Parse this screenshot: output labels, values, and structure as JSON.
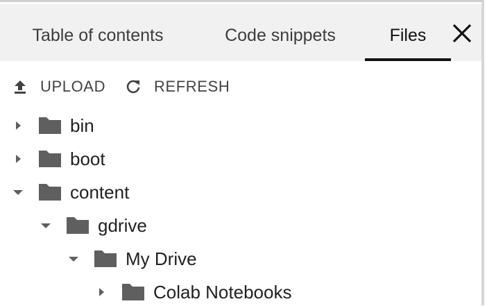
{
  "tabs": [
    {
      "label": "Table of contents"
    },
    {
      "label": "Code snippets"
    },
    {
      "label": "Files",
      "active": true
    }
  ],
  "close_icon": "close-icon",
  "toolbar": {
    "upload_label": "UPLOAD",
    "upload_icon": "upload-icon",
    "refresh_label": "REFRESH",
    "refresh_icon": "refresh-icon"
  },
  "file_tree": [
    {
      "name": "bin",
      "expanded": false,
      "depth": 0
    },
    {
      "name": "boot",
      "expanded": false,
      "depth": 0
    },
    {
      "name": "content",
      "expanded": true,
      "depth": 0
    },
    {
      "name": "gdrive",
      "expanded": true,
      "depth": 1
    },
    {
      "name": "My Drive",
      "expanded": true,
      "depth": 2
    },
    {
      "name": "Colab Notebooks",
      "expanded": false,
      "depth": 3
    }
  ],
  "colors": {
    "tab_bar_bg": "#f1f1f1",
    "active_tab_underline": "#111111",
    "folder_icon": "#5f5f5f",
    "caret": "#5f5f5f"
  }
}
